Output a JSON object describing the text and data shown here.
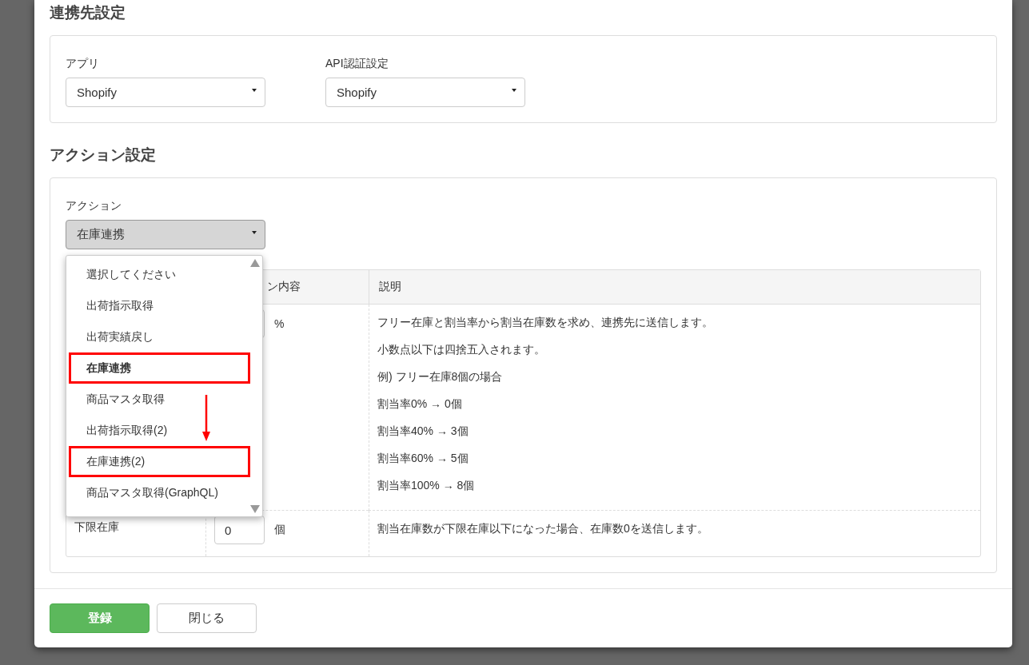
{
  "section_1": {
    "title": "連携先設定",
    "fields": [
      {
        "label": "アプリ",
        "value": "Shopify"
      },
      {
        "label": "API認証設定",
        "value": "Shopify"
      }
    ]
  },
  "section_2": {
    "title": "アクション設定",
    "action": {
      "label": "アクション",
      "value": "在庫連携",
      "expanded": true,
      "options": [
        {
          "label": "選択してください",
          "selected": false,
          "highlighted": false
        },
        {
          "label": "出荷指示取得",
          "selected": false,
          "highlighted": false
        },
        {
          "label": "出荷実績戻し",
          "selected": false,
          "highlighted": false
        },
        {
          "label": "在庫連携",
          "selected": true,
          "highlighted": true
        },
        {
          "label": "商品マスタ取得",
          "selected": false,
          "highlighted": false
        },
        {
          "label": "出荷指示取得(2)",
          "selected": false,
          "highlighted": false
        },
        {
          "label": "在庫連携(2)",
          "selected": false,
          "highlighted": true
        },
        {
          "label": "商品マスタ取得(GraphQL)",
          "selected": false,
          "highlighted": false
        }
      ]
    },
    "table": {
      "column_2": "ン内容",
      "column_3": "説明",
      "rows": [
        {
          "unit": "%",
          "description": [
            "フリー在庫と割当率から割当在庫数を求め、連携先に送信します。",
            "小数点以下は四捨五入されます。",
            "例) フリー在庫8個の場合",
            "割当率0% → 0個",
            "割当率40% → 3個",
            "割当率60% → 5個",
            "割当率100% → 8個"
          ]
        },
        {
          "name": "下限在庫",
          "value": "0",
          "unit": "個",
          "description": [
            "割当在庫数が下限在庫以下になった場合、在庫数0を送信します。"
          ]
        }
      ]
    }
  },
  "buttons": [
    {
      "label": "登録",
      "kind": "primary"
    },
    {
      "label": "閉じる",
      "kind": "default"
    }
  ]
}
